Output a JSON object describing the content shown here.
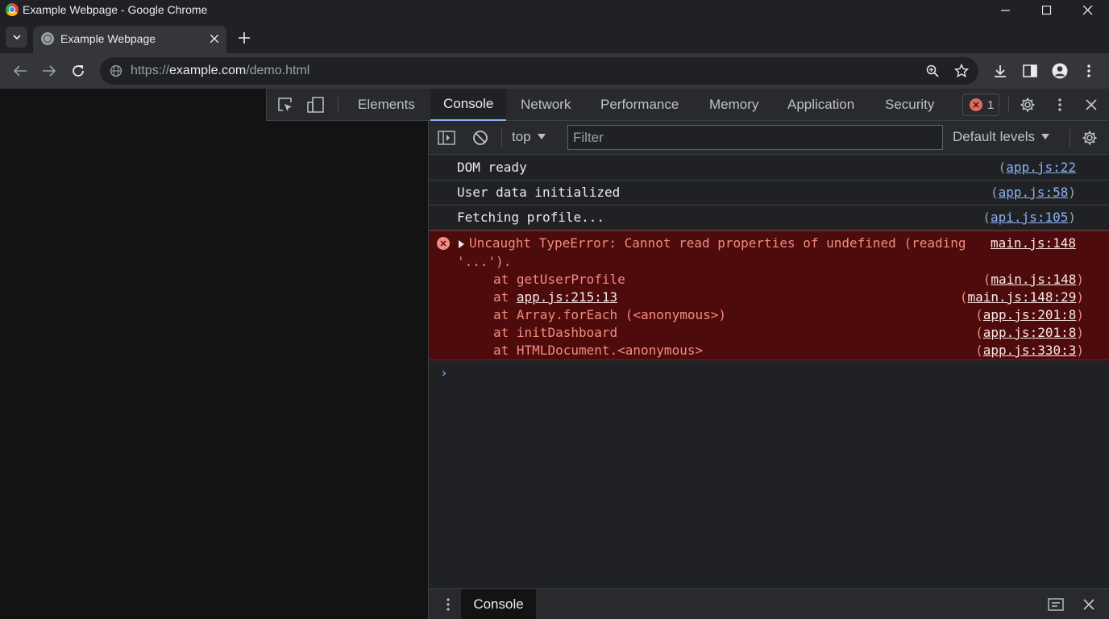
{
  "window": {
    "title": "Example Webpage - Google Chrome"
  },
  "tab": {
    "title": "Example Webpage"
  },
  "omnibox": {
    "scheme": "https://",
    "host": "example.com",
    "path": "/demo.html"
  },
  "devtools": {
    "tabs": [
      "Elements",
      "Console",
      "Network",
      "Performance",
      "Memory",
      "Application",
      "Security"
    ],
    "active_tab": "Console",
    "error_count": "1"
  },
  "console": {
    "context": "top",
    "filter_placeholder": "Filter",
    "levels": "Default levels",
    "messages": [
      {
        "text": "DOM ready",
        "source": "app.js:22"
      },
      {
        "text": "User data initialized",
        "source": "app.js:58"
      },
      {
        "text": "Fetching profile...",
        "source": "api.js:105"
      }
    ],
    "error": {
      "line1": "Uncaught TypeError: Cannot read properties of undefined (reading",
      "line1_src": "main.js:148",
      "line2": "'...').",
      "stack": [
        {
          "prefix": "at ",
          "fn": "getUserProfile",
          "src": "main.js:148"
        },
        {
          "prefix": "at ",
          "fn": "app.js:215:13",
          "src": "main.js:148:29"
        },
        {
          "prefix": "at ",
          "fn": "Array.forEach (<anonymous>)",
          "src": "app.js:201:8"
        },
        {
          "prefix": "at ",
          "fn": "initDashboard",
          "src": "app.js:201:8"
        },
        {
          "prefix": "at ",
          "fn": "HTMLDocument.<anonymous>",
          "src": "app.js:330:3"
        }
      ]
    },
    "prompt": "›"
  },
  "drawer": {
    "tab": "Console"
  },
  "colors": {
    "accent": "#8ab4f8",
    "error_bg": "#4e0b0b",
    "error_text": "#f28b82"
  }
}
